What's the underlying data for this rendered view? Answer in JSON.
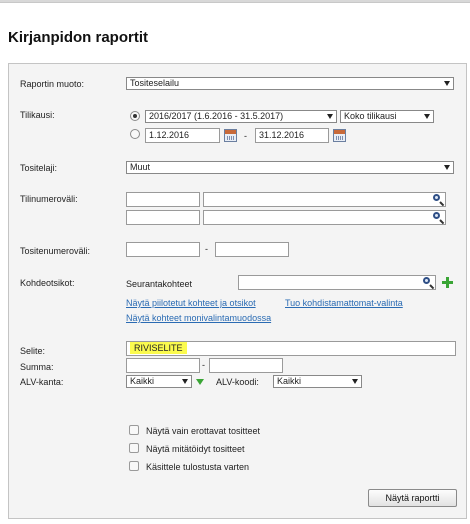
{
  "page": {
    "title": "Kirjanpidon raportit"
  },
  "form": {
    "report_type": {
      "label": "Raportin muoto:",
      "value": "Tositeselailu"
    },
    "period": {
      "label": "Tilikausi:",
      "fiscal_year": "2016/2017 (1.6.2016 - 31.5.2017)",
      "scope": "Koko tilikausi",
      "date_from": "1.12.2016",
      "date_to": "31.12.2016",
      "separator": "-"
    },
    "voucher_type": {
      "label": "Tositelaji:",
      "value": "Muut"
    },
    "account_range": {
      "label": "Tilinumeroväli:",
      "from": "",
      "to": ""
    },
    "voucher_number_range": {
      "label": "Tositenumeroväli:",
      "from": "",
      "to": "",
      "separator": "-"
    },
    "dimensions": {
      "label": "Kohdeotsikot:",
      "tracking_label": "Seurantakohteet",
      "tracking_value": "",
      "link_hidden": "Näytä piilotetut kohteet ja otsikot",
      "link_unallocated": "Tuo kohdistamattomat-valinta",
      "link_multiselect": "Näytä kohteet monivalintamuodossa"
    },
    "description": {
      "label": "Selite:",
      "value": "RIVISELITE"
    },
    "sum": {
      "label": "Summa:",
      "from": "",
      "to": "",
      "separator": "-"
    },
    "vat_rate": {
      "label": "ALV-kanta:",
      "value": "Kaikki"
    },
    "vat_code": {
      "label": "ALV-koodi:",
      "value": "Kaikki"
    },
    "options": {
      "only_diff": "Näytä vain erottavat tositteet",
      "only_voided": "Näytä mitätöidyt tositteet",
      "print_mode": "Käsittele tulostusta varten"
    },
    "submit_label": "Näytä raportti"
  },
  "colors": {
    "highlight": "#fbfb4e",
    "link": "#2a6bb3",
    "plus": "#3aa535",
    "panel": "#f4f4f4"
  }
}
